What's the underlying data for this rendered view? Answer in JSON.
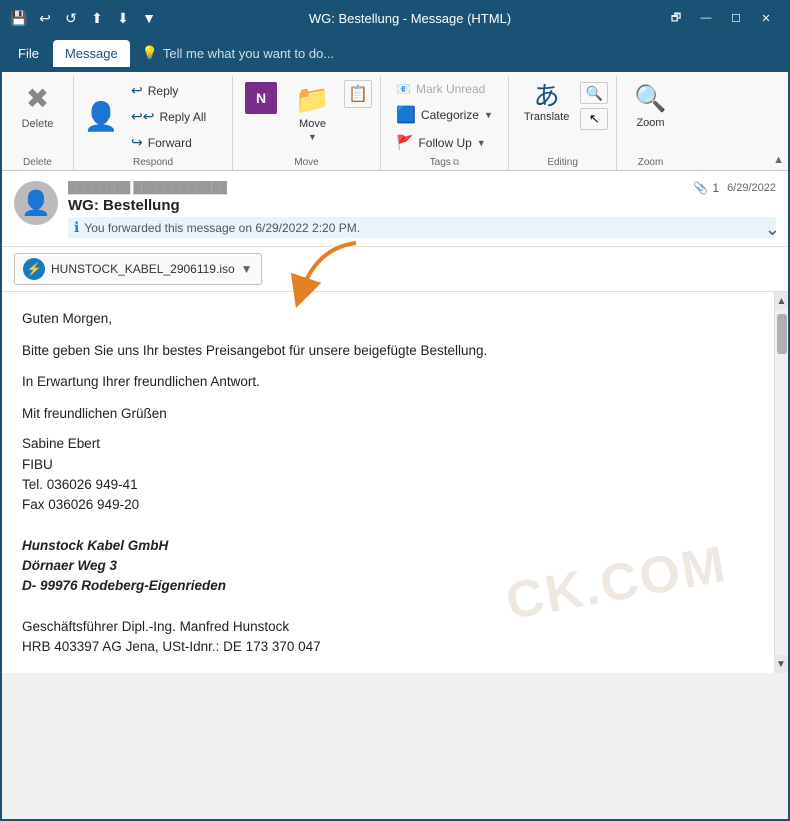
{
  "titlebar": {
    "title": "WG: Bestellung - Message (HTML)",
    "icons": [
      "💾",
      "↩",
      "↺",
      "⬆",
      "⬇",
      "▼"
    ]
  },
  "menubar": {
    "items": [
      "File",
      "Message"
    ],
    "active": "Message",
    "tell_me_placeholder": "Tell me what you want to do..."
  },
  "ribbon": {
    "groups": {
      "delete": {
        "label": "Delete",
        "delete_btn": "Delete"
      },
      "respond": {
        "label": "Respond",
        "reply": "Reply",
        "reply_all": "Reply All",
        "forward": "Forward"
      },
      "move": {
        "label": "Move",
        "move_btn": "Move"
      },
      "tags": {
        "label": "Tags",
        "mark_unread": "Mark Unread",
        "categorize": "Categorize",
        "follow_up": "Follow Up"
      },
      "editing": {
        "label": "Editing",
        "translate": "Translate"
      },
      "zoom": {
        "label": "Zoom",
        "zoom_btn": "Zoom"
      }
    }
  },
  "email": {
    "sender_display": "████████  ████████████",
    "subject": "WG: Bestellung",
    "date": "6/29/2022",
    "forwarded_notice": "You forwarded this message on 6/29/2022 2:20 PM.",
    "attachment_count": "1",
    "attachment": {
      "name": "HUNSTOCK_KABEL_2906119.iso",
      "icon": "⚡"
    },
    "body": {
      "greeting": "Guten Morgen,",
      "line1": "Bitte geben Sie uns Ihr bestes Preisangebot für unsere beigefügte Bestellung.",
      "line2": "In Erwartung Ihrer freundlichen Antwort.",
      "closing": "Mit freundlichen Grüßen",
      "name": "Sabine Ebert",
      "dept": "FIBU",
      "tel": "Tel. 036026 949-41",
      "fax": "Fax 036026 949-20",
      "company": "Hunstock Kabel GmbH",
      "address1": "Dörnaer Weg 3",
      "address2": "D- 99976 Rodeberg-Eigenrieden",
      "geschaeftsfuehrer": "Geschäftsführer  Dipl.-Ing. Manfred Hunstock",
      "hrb": "HRB 403397 AG Jena, USt-Idnr.: DE 173 370 047"
    }
  },
  "watermark": "CK.COM"
}
